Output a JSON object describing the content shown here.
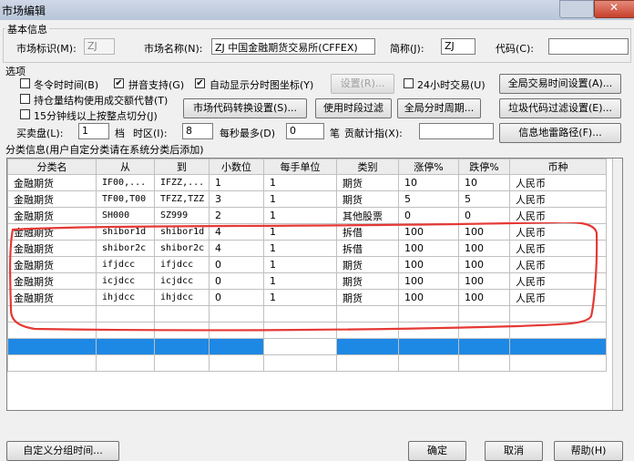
{
  "window": {
    "title": "市场编辑"
  },
  "basic_info": {
    "group_label": "基本信息",
    "market_id_label": "市场标识(M):",
    "market_id_value": "ZJ",
    "market_name_label": "市场名称(N):",
    "market_name_value": "ZJ 中国金融期货交易所(CFFEX)",
    "short_name_label": "简称(J):",
    "short_name_value": "ZJ",
    "code_label": "代码(C):",
    "code_value": ""
  },
  "options": {
    "group_label": "选项",
    "cb_winter_time": {
      "label": "冬令时时间(B)",
      "checked": false
    },
    "cb_pinyin": {
      "label": "拼音支持(G)",
      "checked": true
    },
    "cb_auto_coord": {
      "label": "自动显示分时图坐标(Y)",
      "checked": true
    },
    "btn_settings": "设置(R)...",
    "cb_24h": {
      "label": "24小时交易(U)",
      "checked": false
    },
    "btn_global_trade_time": "全局交易时间设置(A)...",
    "cb_position_volume": {
      "label": "持仓量结构使用成交额代替(T)",
      "checked": false
    },
    "cb_15min": {
      "label": "15分钟线以上按整点切分(J)",
      "checked": false
    },
    "btn_code_convert": "市场代码转换设置(S)...",
    "btn_time_filter": "使用时段过滤",
    "btn_global_period": "全局分时周期...",
    "btn_junk_filter": "垃圾代码过滤设置(E)...",
    "buysell_label": "买卖盘(L):",
    "buysell_value": "1",
    "buysell_unit": "档",
    "timezone_label": "时区(I):",
    "timezone_value": "8",
    "per_second_label": "每秒最多(D)",
    "per_second_value": "0",
    "per_second_unit": "笔",
    "contribution_label": "贡献计指(X):",
    "contribution_value": "",
    "btn_info_mine": "信息地雷路径(F)..."
  },
  "category": {
    "group_label": "分类信息(用户自定分类请在系统分类后添加)",
    "headers": [
      "分类名",
      "从",
      "到",
      "小数位",
      "每手单位",
      "类别",
      "涨停%",
      "跌停%",
      "币种"
    ],
    "rows": [
      [
        "金融期货",
        "IF00,...",
        "IFZZ,...",
        "1",
        "1",
        "期货",
        "10",
        "10",
        "人民币"
      ],
      [
        "金融期货",
        "TF00,T00",
        "TFZZ,TZZ",
        "3",
        "1",
        "期货",
        "5",
        "5",
        "人民币"
      ],
      [
        "金融期货",
        "SH000",
        "SZ999",
        "2",
        "1",
        "其他股票",
        "0",
        "0",
        "人民币"
      ],
      [
        "金融期货",
        "shibor1d",
        "shibor1d",
        "4",
        "1",
        "拆借",
        "100",
        "100",
        "人民币"
      ],
      [
        "金融期货",
        "shibor2c",
        "shibor2c",
        "4",
        "1",
        "拆借",
        "100",
        "100",
        "人民币"
      ],
      [
        "金融期货",
        "ifjdcc",
        "ifjdcc",
        "0",
        "1",
        "期货",
        "100",
        "100",
        "人民币"
      ],
      [
        "金融期货",
        "icjdcc",
        "icjdcc",
        "0",
        "1",
        "期货",
        "100",
        "100",
        "人民币"
      ],
      [
        "金融期货",
        "ihjdcc",
        "ihjdcc",
        "0",
        "1",
        "期货",
        "100",
        "100",
        "人民币"
      ]
    ],
    "empty_rows": 4
  },
  "footer": {
    "btn_custom_group": "自定义分组时间...",
    "btn_ok": "确定",
    "btn_cancel": "取消",
    "btn_help": "帮助(H)"
  },
  "colors": {
    "selection": "#1e88e5",
    "annotation": "#e53935"
  }
}
